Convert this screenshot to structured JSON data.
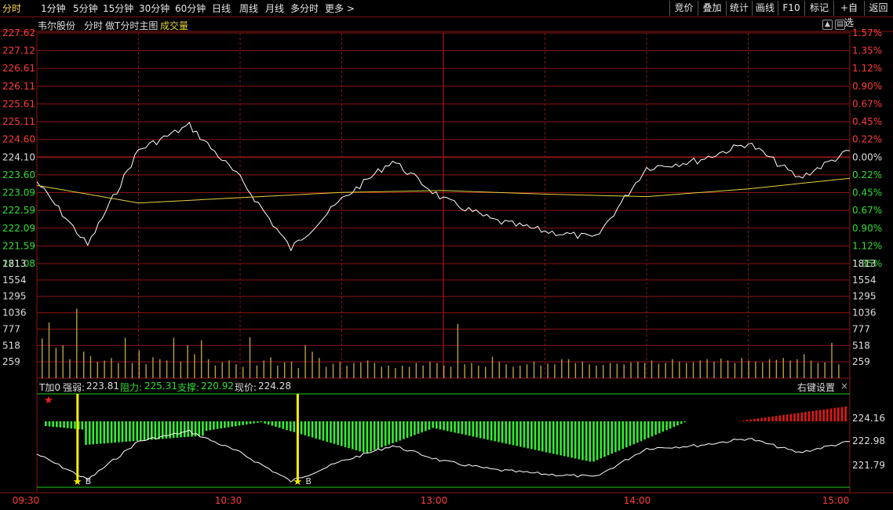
{
  "toolbar": {
    "periods": [
      "分时",
      "1分钟",
      "5分钟",
      "15分钟",
      "30分钟",
      "60分钟",
      "日线",
      "周线",
      "月线",
      "多分时",
      "更多"
    ],
    "active_period": "分时",
    "more_label": "更多 >",
    "right_buttons": [
      "竞价",
      "叠加",
      "统计",
      "画线",
      "F10",
      "标记",
      "+自选",
      "返回"
    ]
  },
  "main_panel": {
    "stock_name": "韦尔股份",
    "mode_label": "分时",
    "template_label": "做T分时主图",
    "volume_label": "成交量",
    "prev_close": 224.1
  },
  "indicator_panel": {
    "title": "T加0",
    "strength_label": "强弱:",
    "strength_value": "223.81",
    "resistance_label": "阻力:",
    "resistance_value": "225.31",
    "support_label": "支撑:",
    "support_value": "220.92",
    "price_label": "现价:",
    "price_value": "224.28",
    "settings_label": "右键设置",
    "close_glyph": "×",
    "buy_marker_label": "B"
  },
  "colors": {
    "background": "#000000",
    "grid": "#8b1414",
    "price_line": "#ffffff",
    "avg_line": "#e6d23c",
    "volume_bar": "#b8a040",
    "up_text": "#ff3c3c",
    "down_text": "#33dd33",
    "neutral_text": "#dddddd",
    "support_line": "#22cc22",
    "marker": "#ffee00"
  },
  "chart_data": [
    {
      "type": "line",
      "title": "",
      "series": [
        {
          "name": "",
          "x": [
            "09:30",
            "09:45",
            "10:00",
            "10:15",
            "10:30",
            "10:45",
            "11:00",
            "11:15",
            "11:30",
            "13:15",
            "13:30",
            "13:45",
            "14:00",
            "14:15",
            "14:30",
            "14:45",
            "15:00"
          ],
          "values": [
            223.4,
            221.6,
            224.3,
            225.0,
            223.5,
            221.5,
            222.9,
            224.0,
            222.9,
            222.3,
            222.0,
            221.8,
            223.8,
            224.0,
            224.5,
            223.5,
            224.28
          ]
        },
        {
          "name": "",
          "x": [
            "09:30",
            "10:00",
            "10:30",
            "11:00",
            "11:30",
            "13:30",
            "14:00",
            "14:30",
            "15:00"
          ],
          "values": [
            223.3,
            222.8,
            222.95,
            223.1,
            223.15,
            223.05,
            222.98,
            223.2,
            223.5
          ]
        }
      ],
      "price_ticks": [
        227.62,
        227.12,
        226.61,
        226.11,
        225.61,
        225.11,
        224.6,
        224.1,
        223.6,
        223.09,
        222.59,
        222.09,
        221.59,
        221.08
      ],
      "pct_ticks": [
        "1.57%",
        "1.35%",
        "1.12%",
        "0.90%",
        "0.67%",
        "0.45%",
        "0.22%",
        "0.00%",
        "0.22%",
        "0.45%",
        "0.67%",
        "0.90%",
        "1.12%",
        "1.35%"
      ],
      "ylim": [
        221.08,
        227.62
      ],
      "x_ticks": [
        "09:30",
        "10:30",
        "13:00",
        "14:00",
        "15:00"
      ],
      "grid": true
    },
    {
      "type": "bar",
      "title": "",
      "y_ticks": [
        1813,
        1554,
        1295,
        1036,
        777,
        518,
        259
      ],
      "ylim": [
        0,
        1813
      ],
      "values_sample": [
        630,
        880,
        480,
        520,
        300,
        1100,
        420,
        350,
        260,
        280,
        320,
        240,
        640,
        240,
        440,
        220,
        330,
        300,
        280,
        640,
        260,
        520,
        380,
        600,
        300,
        200,
        250,
        280,
        220,
        180,
        650,
        200,
        280,
        330,
        200,
        250,
        260,
        160,
        520,
        420,
        320,
        180,
        230,
        260,
        200,
        240,
        250,
        280,
        240,
        180,
        200,
        160,
        200,
        180,
        240,
        200,
        260,
        240,
        200,
        180,
        860,
        220,
        240,
        200,
        180,
        340,
        260,
        220,
        180,
        200,
        220,
        260,
        200,
        230,
        220,
        300,
        300,
        240,
        260,
        220,
        200,
        210,
        240,
        230,
        220,
        250,
        260,
        240,
        280,
        230,
        240,
        300,
        260,
        240,
        250,
        280,
        300,
        260,
        310,
        280,
        240,
        320,
        280,
        260,
        250,
        300,
        290,
        320,
        280,
        300,
        380,
        280,
        240,
        250,
        560,
        220
      ]
    },
    {
      "type": "area",
      "title": "",
      "y_ticks": [
        224.16,
        222.98,
        221.79
      ],
      "resistance": 225.31,
      "support": 220.92,
      "strength": 223.81,
      "buy_marks_time": [
        "09:42",
        "10:47"
      ]
    }
  ]
}
